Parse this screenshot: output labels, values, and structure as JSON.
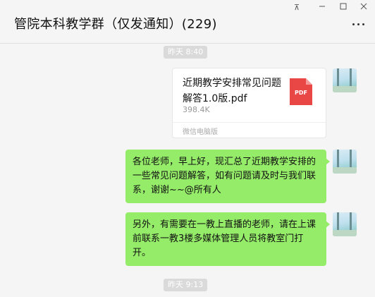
{
  "window": {
    "title": "管院本科教学群（仅发通知）(229)",
    "controls": [
      "pin",
      "minimize",
      "maximize",
      "close"
    ]
  },
  "more_icon": "more-horizontal-icon",
  "messages": [
    {
      "type": "time",
      "text": "昨天 8:40"
    },
    {
      "type": "file",
      "file_name": "近期教学安排常见问题解答1.0版.pdf",
      "file_size": "398.4K",
      "file_type_label": "PDF",
      "source": "微信电脑版",
      "icon": "pdf-file-icon"
    },
    {
      "type": "text",
      "text": "各位老师，早上好，现汇总了近期教学安排的一些常见问题解答，如有问题请及时与我们联系，谢谢~~@所有人"
    },
    {
      "type": "text",
      "text": "另外，有需要在一教上直播的老师，请在上课前联系一教3楼多媒体管理人员将教室门打开。"
    },
    {
      "type": "time",
      "text": "昨天 9:13"
    }
  ],
  "colors": {
    "bubble_green": "#95ec69",
    "pdf_red": "#e94646",
    "background": "#f5f5f5"
  }
}
